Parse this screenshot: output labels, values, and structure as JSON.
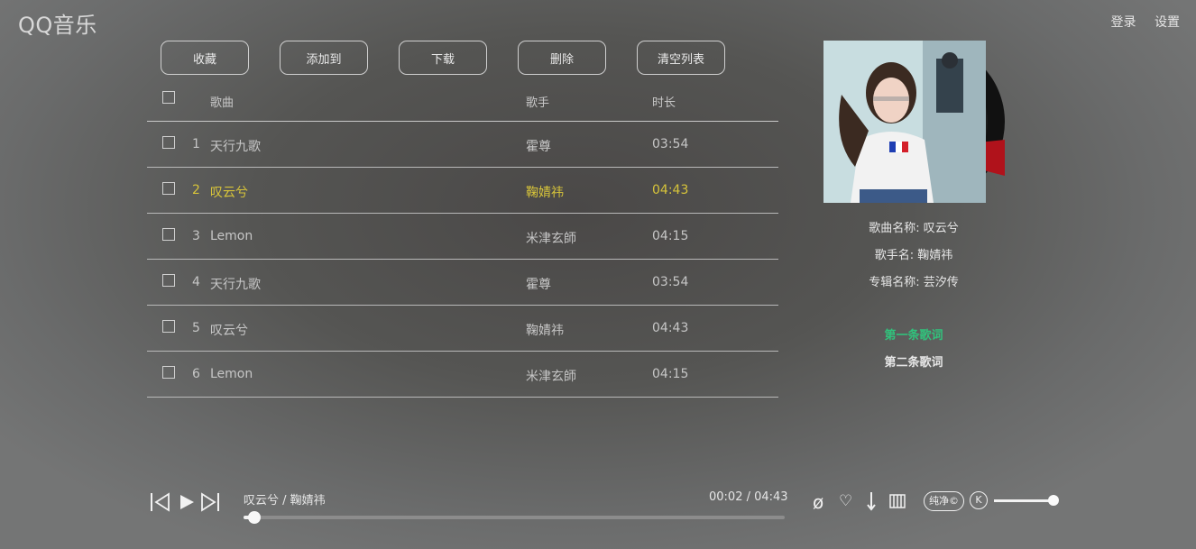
{
  "app": {
    "logo": "QQ音乐"
  },
  "topnav": {
    "login": "登录",
    "settings": "设置"
  },
  "toolbar": [
    "收藏",
    "添加到",
    "下载",
    "删除",
    "清空列表"
  ],
  "list": {
    "headers": {
      "song": "歌曲",
      "singer": "歌手",
      "duration": "时长"
    },
    "rows": [
      {
        "num": "1",
        "song": "天行九歌",
        "singer": "霍尊",
        "duration": "03:54"
      },
      {
        "num": "2",
        "song": "叹云兮",
        "singer": "鞠婧祎",
        "duration": "04:43",
        "active": true
      },
      {
        "num": "3",
        "song": "Lemon",
        "singer": "米津玄師",
        "duration": "04:15"
      },
      {
        "num": "4",
        "song": "天行九歌",
        "singer": "霍尊",
        "duration": "03:54"
      },
      {
        "num": "5",
        "song": "叹云兮",
        "singer": "鞠婧祎",
        "duration": "04:43"
      },
      {
        "num": "6",
        "song": "Lemon",
        "singer": "米津玄師",
        "duration": "04:15"
      }
    ]
  },
  "info": {
    "song_name": "歌曲名称: 叹云兮",
    "singer_name": "歌手名: 鞠婧祎",
    "album_name": "专辑名称: 芸汐传",
    "lyric_1": "第一条歌词",
    "lyric_2": "第二条歌词"
  },
  "player": {
    "now_playing": "叹云兮 / 鞠婧祎",
    "time": "00:02 / 04:43",
    "progress_fraction": 0.02,
    "volume_fraction": 1.0,
    "pure_label": "纯净",
    "k_label": "K"
  },
  "colors": {
    "accent_green": "#31c27c",
    "active_row": "#d7c43a"
  }
}
